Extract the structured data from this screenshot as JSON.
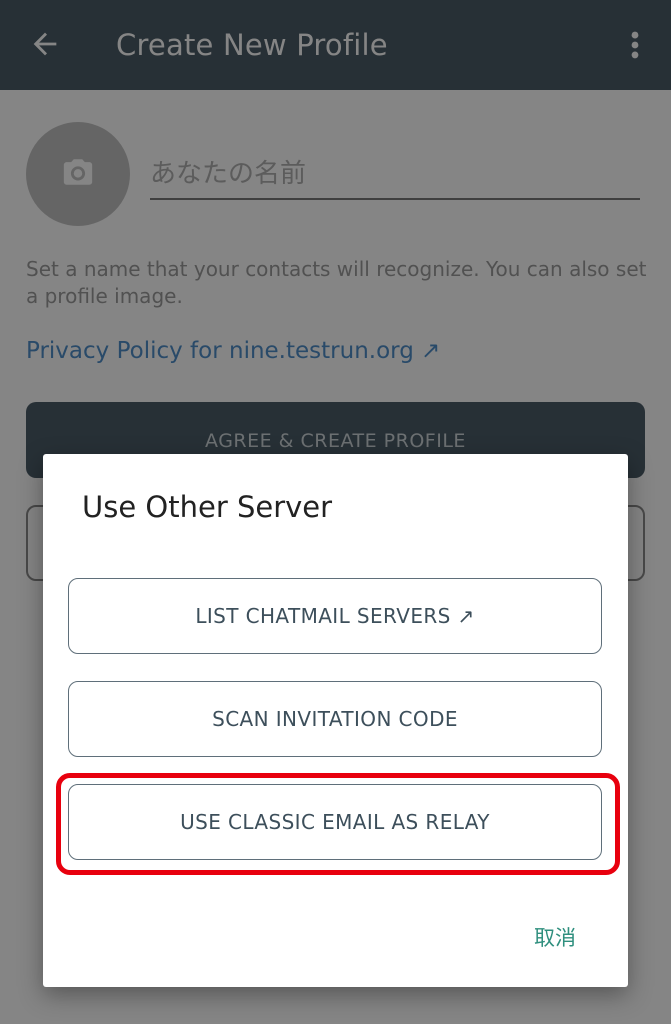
{
  "appbar": {
    "title": "Create New Profile",
    "back_icon": "arrow-left-icon",
    "menu_icon": "more-vert-icon"
  },
  "profile": {
    "avatar_icon": "camera-icon",
    "name_placeholder": "あなたの名前",
    "hint": "Set a name that your contacts will recognize. You can also set a profile image.",
    "privacy_link": "Privacy Policy for nine.testrun.org ↗",
    "agree_label": "AGREE & CREATE PROFILE"
  },
  "dialog": {
    "title": "Use Other Server",
    "options": [
      {
        "label": "LIST CHATMAIL SERVERS ↗"
      },
      {
        "label": "SCAN INVITATION CODE"
      },
      {
        "label": "USE CLASSIC EMAIL AS RELAY"
      }
    ],
    "cancel_label": "取消"
  },
  "colors": {
    "appbar": "#4c5d68",
    "accent_link": "#4f8fc9",
    "cancel_text": "#2f8f7e",
    "highlight": "#e8000e"
  }
}
